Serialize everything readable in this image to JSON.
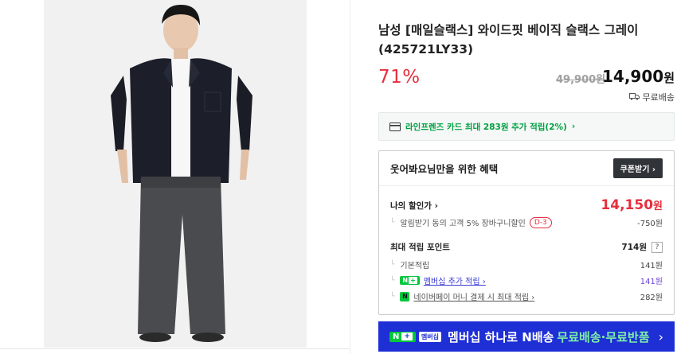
{
  "product": {
    "title": "남성 [매일슬랙스] 와이드핏 베이직 슬랙스 그레이 (425721LY33)",
    "discount_rate": "71%",
    "original_price": "49,900원",
    "price_number": "14,900",
    "price_unit": "원",
    "shipping_label": "무료배송"
  },
  "card_promo": {
    "text": "라인프렌즈 카드 최대 283원 추가 적립(2%)",
    "chevron": "›"
  },
  "benefit": {
    "title": "웃어봐요님만을 위한 혜택",
    "coupon_button": "쿠폰받기 ›",
    "my_discount_label": "나의 할인가 ›",
    "my_discount_price_number": "14,150",
    "my_discount_price_unit": "원",
    "alarm_label": "알림받기 동의 고객 5% 장바구니할인",
    "alarm_badge": "D-3",
    "alarm_value": "-750원",
    "max_point_label": "최대 적립 포인트",
    "max_point_value": "714원",
    "help_mark": "?",
    "base_label": "기본적립",
    "base_value": "141원",
    "membership_label": "멤버십 추가 적립 ›",
    "membership_value": "141원",
    "npay_label": "네이버페이 머니 결제 시 최대 적립 ›",
    "npay_value": "282원"
  },
  "banner": {
    "brand_n": "N",
    "brand_plus": "+",
    "tag": "멤버십",
    "text": "멤버십 하나로 N배송",
    "highlight": "무료배송·무료반품",
    "chevron": "›"
  },
  "colors": {
    "accent_red": "#e62e3d",
    "naver_green": "#00c73c",
    "banner_blue": "#1e2fd6"
  }
}
